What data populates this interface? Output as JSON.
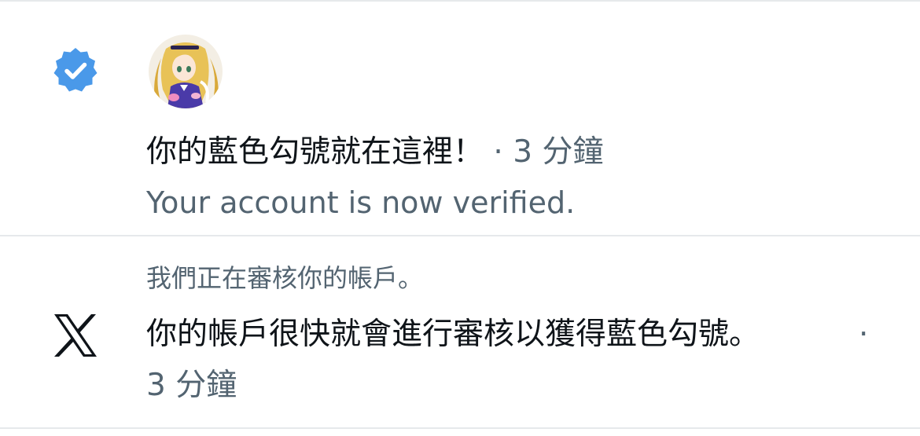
{
  "notifications": [
    {
      "icon": "verified-badge-icon",
      "avatar": "anime-girl-avatar",
      "title": "你的藍色勾號就在這裡！",
      "separator": "·",
      "time": "3 分鐘",
      "subtitle": "Your account is now verified.",
      "accent_color": "#4a99e9"
    },
    {
      "context": "我們正在審核你的帳戶。",
      "icon": "x-logo-icon",
      "message": "你的帳戶很快就會進行審核以獲得藍色勾號。",
      "separator": "·",
      "time": "3 分鐘"
    }
  ],
  "colors": {
    "primary_text": "#0f1419",
    "secondary_text": "#536471",
    "divider": "#e6e9eb",
    "verified_blue": "#4a99e9"
  }
}
